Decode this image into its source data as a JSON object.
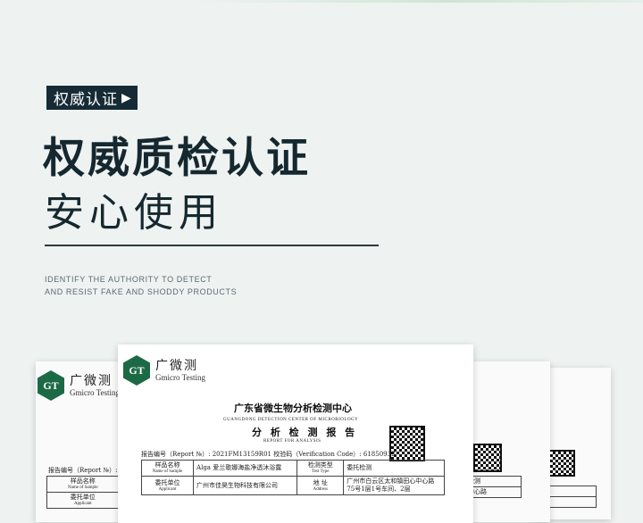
{
  "badge": {
    "label": "权威认证",
    "arrow": "▶"
  },
  "headline": {
    "line1": "权威质检认证",
    "line2": "安心使用"
  },
  "tagline": {
    "line1": "IDENTIFY THE AUTHORITY TO DETECT",
    "line2": "AND RESIST FAKE AND SHODDY PRODUCTS"
  },
  "certificate": {
    "logo_mark": "GT",
    "logo_cn": "广微测",
    "logo_en": "Gmicro Testing",
    "org_cn": "广东省微生物分析检测中心",
    "org_en": "GUANGDONG   DETECTION   CENTER   OF   MICROBIOLOGY",
    "report_cn": "分 析 检 测 报 告",
    "report_en": "REPORT   FOR   ANALYSIS",
    "report_line": "报告编号（Report №）: 2021FM13159R01  校验码（Verification Code）: 61850932",
    "rows": [
      {
        "label_cn": "样品名称",
        "label_en": "Name of Sample",
        "value": "Alga 爱兰歌娜海盐净透沐浴露",
        "label2_cn": "检测类型",
        "label2_en": "Test Type",
        "value2": "委托检测"
      },
      {
        "label_cn": "委托单位",
        "label_en": "Applicant",
        "value": "广州市佳昊生物科技有限公司",
        "label2_cn": "地    址",
        "label2_en": "Address",
        "value2": "广州市白云区太和镇田心中心路75号1层1号车间、2层"
      }
    ],
    "left_report_line": "报告编号（Report №）: 2",
    "left_value_fragment": "Al"
  },
  "back_sheet": {
    "cell_a": "检测",
    "cell_b": "心路",
    "cell_c": "中心路"
  }
}
